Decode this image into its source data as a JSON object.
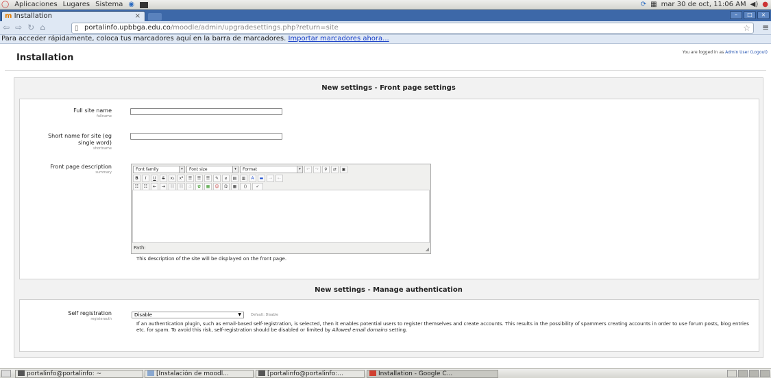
{
  "gnome_panel": {
    "menus": [
      "Aplicaciones",
      "Lugares",
      "Sistema"
    ],
    "clock": "mar 30 de oct, 11:06 AM"
  },
  "browser": {
    "tab_title": "Installation",
    "tab_close": "×",
    "url_host": "portalinfo.upbbga.edu.co",
    "url_path": "/moodle/admin/upgradesettings.php?return=site",
    "bookmarks_text": "Para acceder rápidamente, coloca tus marcadores aquí en la barra de marcadores.",
    "bookmarks_link": "Importar marcadores ahora..."
  },
  "page": {
    "title": "Installation",
    "login_prefix": "You are logged in as",
    "login_user": "Admin User",
    "logout": "(Logout)"
  },
  "front_page_section": {
    "title": "New settings - Front page settings",
    "fullname_label": "Full site name",
    "fullname_key": "fullname",
    "shortname_label": "Short name for site (eg single word)",
    "shortname_key": "shortname",
    "summary_label": "Front page description",
    "summary_key": "summary",
    "editor": {
      "font_family": "Font family",
      "font_size": "Font size",
      "format": "Format",
      "path_label": "Path:"
    },
    "summary_help": "This description of the site will be displayed on the front page."
  },
  "auth_section": {
    "title": "New settings - Manage authentication",
    "label": "Self registration",
    "key": "registerauth",
    "selected": "Disable",
    "default_text": "Default: Disable",
    "help_text": "If an authentication plugin, such as email-based self-registration, is selected, then it enables potential users to register themselves and create accounts. This results in the possibility of spammers creating accounts in order to use forum posts, blog entries etc. for spam. To avoid this risk, self-registration should be disabled or limited by",
    "help_em": "Allowed email domains",
    "help_tail": "setting."
  },
  "taskbar": {
    "tasks": [
      "portalinfo@portalinfo: ~",
      "[Instalación de moodl...",
      "[portalinfo@portalinfo:...",
      "Installation - Google C..."
    ]
  }
}
